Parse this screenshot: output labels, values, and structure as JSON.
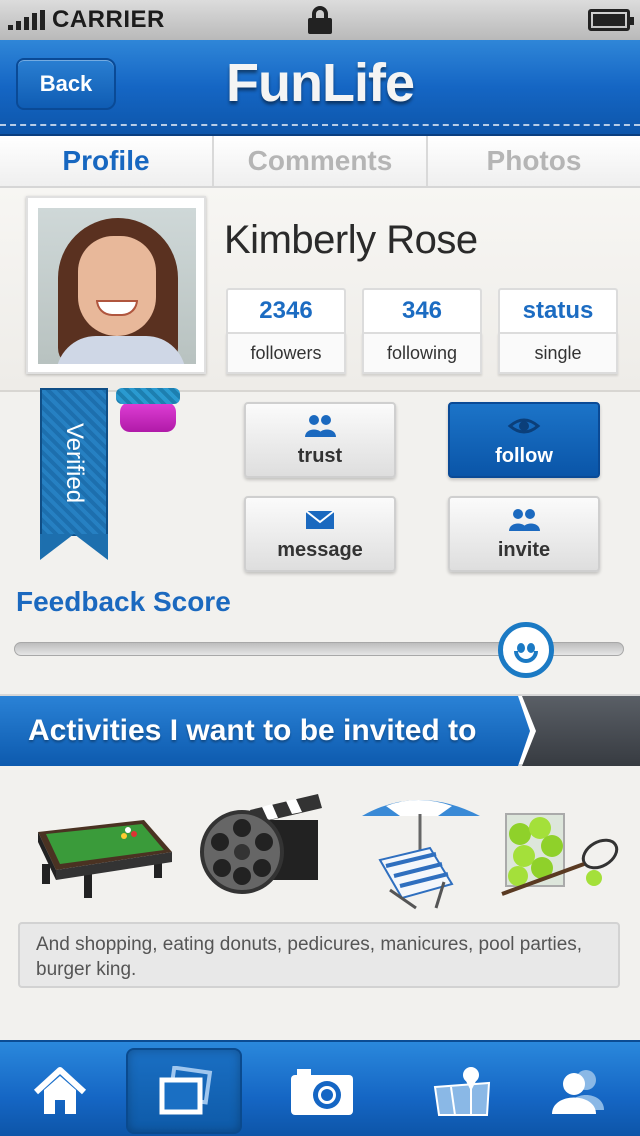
{
  "status_bar": {
    "carrier": "CARRIER"
  },
  "header": {
    "back_label": "Back",
    "title": "FunLife"
  },
  "tabs": [
    {
      "label": "Profile",
      "active": true
    },
    {
      "label": "Comments",
      "active": false
    },
    {
      "label": "Photos",
      "active": false
    }
  ],
  "profile": {
    "name": "Kimberly Rose",
    "stats": [
      {
        "value": "2346",
        "label": "followers"
      },
      {
        "value": "346",
        "label": "following"
      },
      {
        "value": "status",
        "label": "single"
      }
    ],
    "badge_label": "Verified"
  },
  "actions": {
    "trust": "trust",
    "follow": "follow",
    "message": "message",
    "invite": "invite"
  },
  "feedback": {
    "title": "Feedback Score",
    "level": 0.86
  },
  "activities": {
    "title": "Activities I want to be invited to",
    "items": [
      "pool-table-icon",
      "film-reel-icon",
      "beach-chair-icon",
      "tennis-icon"
    ],
    "note": "And shopping, eating donuts, pedicures, manicures, pool parties, burger king."
  },
  "tabbar": {
    "items": [
      "home-icon",
      "photos-icon",
      "camera-icon",
      "map-icon",
      "contacts-icon"
    ],
    "active_index": 1
  },
  "colors": {
    "accent": "#1566c4",
    "link": "#1767c0",
    "follow_button": "#0a55a8"
  }
}
